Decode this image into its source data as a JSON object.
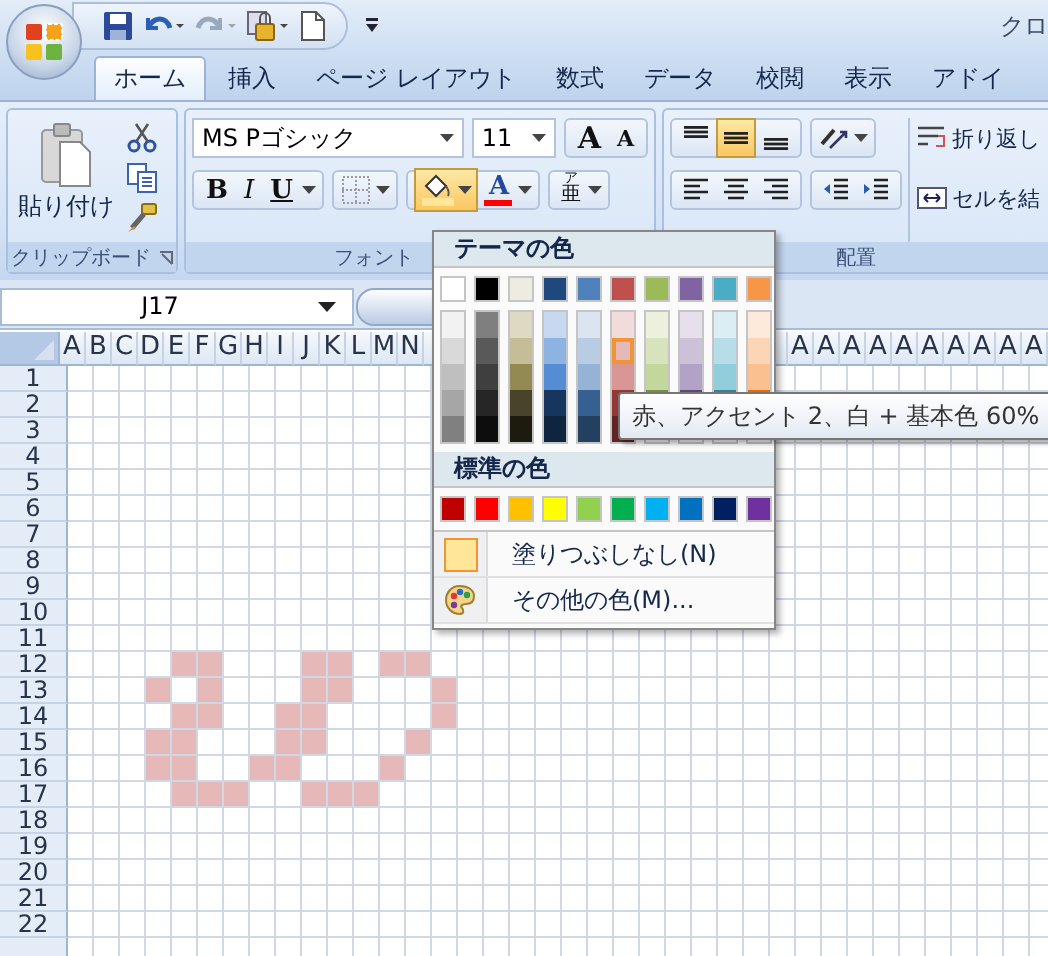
{
  "title": "クロ",
  "tabs": [
    {
      "label": "ホーム",
      "selected": true
    },
    {
      "label": "挿入",
      "selected": false
    },
    {
      "label": "ページ レイアウト",
      "selected": false
    },
    {
      "label": "数式",
      "selected": false
    },
    {
      "label": "データ",
      "selected": false
    },
    {
      "label": "校閲",
      "selected": false
    },
    {
      "label": "表示",
      "selected": false
    },
    {
      "label": "アドイ",
      "selected": false
    }
  ],
  "clipboard": {
    "paste_label": "貼り付け",
    "group_label": "クリップボード"
  },
  "font": {
    "font_name": "MS Pゴシック",
    "font_size": "11",
    "grow_glyph": "A",
    "shrink_glyph": "A",
    "bold": "B",
    "italic": "I",
    "underline": "U",
    "fill_button": {
      "open": true,
      "color": "#ffe699"
    },
    "font_color_button": {
      "glyph": "A",
      "color": "#ff0000"
    },
    "phonetic_ruby": "ア",
    "phonetic_glyph": "亜",
    "group_label": "フォント"
  },
  "alignment": {
    "vertical": [
      {
        "selected": false
      },
      {
        "selected": true
      },
      {
        "selected": false
      }
    ],
    "wrap_text": "折り返し",
    "merge": "セルを結",
    "group_label": "配置"
  },
  "name_box": "J17",
  "sheet": {
    "columns_left": [
      "A",
      "B",
      "C",
      "D",
      "E",
      "F",
      "G",
      "H",
      "I",
      "J",
      "K",
      "L",
      "M",
      "N"
    ],
    "columns_right": [
      "A",
      "A",
      "A",
      "A",
      "A",
      "A",
      "A",
      "A",
      "A",
      "A"
    ],
    "fill": {
      "color": "#e6b8b7"
    },
    "rows": [
      {
        "label": "1"
      },
      {
        "label": "2"
      },
      {
        "label": "3"
      },
      {
        "label": "4"
      },
      {
        "label": "5"
      },
      {
        "label": "6"
      },
      {
        "label": "7"
      },
      {
        "label": "8"
      },
      {
        "label": "9"
      },
      {
        "label": "10"
      },
      {
        "label": "11"
      },
      {
        "label": "12",
        "filled": [
          false,
          false,
          false,
          false,
          true,
          true,
          false,
          false,
          false,
          true,
          true,
          false,
          true,
          true,
          false
        ]
      },
      {
        "label": "13",
        "filled": [
          false,
          false,
          false,
          true,
          false,
          true,
          false,
          false,
          false,
          true,
          true,
          false,
          false,
          false,
          true
        ]
      },
      {
        "label": "14",
        "filled": [
          false,
          false,
          false,
          false,
          true,
          true,
          false,
          false,
          true,
          true,
          false,
          false,
          false,
          false,
          true
        ]
      },
      {
        "label": "15",
        "filled": [
          false,
          false,
          false,
          true,
          true,
          false,
          false,
          false,
          true,
          true,
          false,
          false,
          false,
          true,
          false
        ]
      },
      {
        "label": "16",
        "filled": [
          false,
          false,
          false,
          true,
          true,
          false,
          false,
          true,
          true,
          false,
          false,
          false,
          true,
          false,
          false
        ]
      },
      {
        "label": "17",
        "filled": [
          false,
          false,
          false,
          false,
          true,
          true,
          true,
          false,
          false,
          true,
          true,
          true,
          false,
          false,
          false
        ]
      },
      {
        "label": "18"
      },
      {
        "label": "19"
      },
      {
        "label": "20"
      },
      {
        "label": "21"
      },
      {
        "label": "22"
      }
    ]
  },
  "color_menu": {
    "theme_heading": "テーマの色",
    "theme_colors": [
      {
        "color": "#ffffff",
        "shades": [
          {
            "color": "#f2f2f2",
            "selected": false
          },
          {
            "color": "#d9d9d9",
            "selected": false
          },
          {
            "color": "#bfbfbf",
            "selected": false
          },
          {
            "color": "#a6a6a6",
            "selected": false
          },
          {
            "color": "#808080",
            "selected": false
          }
        ]
      },
      {
        "color": "#000000",
        "shades": [
          {
            "color": "#7f7f7f",
            "selected": false
          },
          {
            "color": "#595959",
            "selected": false
          },
          {
            "color": "#3f3f3f",
            "selected": false
          },
          {
            "color": "#262626",
            "selected": false
          },
          {
            "color": "#0d0d0d",
            "selected": false
          }
        ]
      },
      {
        "color": "#eeece1",
        "shades": [
          {
            "color": "#ddd9c3",
            "selected": false
          },
          {
            "color": "#c4bd97",
            "selected": false
          },
          {
            "color": "#938953",
            "selected": false
          },
          {
            "color": "#494429",
            "selected": false
          },
          {
            "color": "#1d1b10",
            "selected": false
          }
        ]
      },
      {
        "color": "#1f497d",
        "shades": [
          {
            "color": "#c6d9f0",
            "selected": false
          },
          {
            "color": "#8db3e2",
            "selected": false
          },
          {
            "color": "#548dd4",
            "selected": false
          },
          {
            "color": "#17365d",
            "selected": false
          },
          {
            "color": "#0f243e",
            "selected": false
          }
        ]
      },
      {
        "color": "#4f81bd",
        "shades": [
          {
            "color": "#dbe5f1",
            "selected": false
          },
          {
            "color": "#b8cce4",
            "selected": false
          },
          {
            "color": "#95b3d7",
            "selected": false
          },
          {
            "color": "#366092",
            "selected": false
          },
          {
            "color": "#244061",
            "selected": false
          }
        ]
      },
      {
        "color": "#c0504d",
        "shades": [
          {
            "color": "#f2dcdb",
            "selected": false
          },
          {
            "color": "#e5b9b7",
            "selected": true
          },
          {
            "color": "#d99694",
            "selected": false
          },
          {
            "color": "#953734",
            "selected": false
          },
          {
            "color": "#632423",
            "selected": false
          }
        ]
      },
      {
        "color": "#9bbb59",
        "shades": [
          {
            "color": "#ebf1dd",
            "selected": false
          },
          {
            "color": "#d7e3bc",
            "selected": false
          },
          {
            "color": "#c3d69b",
            "selected": false
          },
          {
            "color": "#76923c",
            "selected": false
          }
        ]
      },
      {
        "color": "#8064a2",
        "shades": [
          {
            "color": "#e5e0ec",
            "selected": false
          },
          {
            "color": "#ccc1d9",
            "selected": false
          },
          {
            "color": "#b2a2c7",
            "selected": false
          },
          {
            "color": "#5f497a",
            "selected": false
          }
        ]
      },
      {
        "color": "#4bacc6",
        "shades": [
          {
            "color": "#dbeef3",
            "selected": false
          },
          {
            "color": "#b7dde8",
            "selected": false
          },
          {
            "color": "#92cddc",
            "selected": false
          },
          {
            "color": "#31859b",
            "selected": false
          }
        ]
      },
      {
        "color": "#f79646",
        "shades": [
          {
            "color": "#fdeada",
            "selected": false
          },
          {
            "color": "#fbd5b5",
            "selected": false
          },
          {
            "color": "#fac08f",
            "selected": false
          },
          {
            "color": "#e36c09",
            "selected": false
          }
        ]
      }
    ],
    "standard_heading": "標準の色",
    "standard_colors": [
      {
        "color": "#c00000"
      },
      {
        "color": "#ff0000"
      },
      {
        "color": "#ffc000"
      },
      {
        "color": "#ffff00"
      },
      {
        "color": "#92d050"
      },
      {
        "color": "#00b050"
      },
      {
        "color": "#00b0f0"
      },
      {
        "color": "#0070c0"
      },
      {
        "color": "#002060"
      },
      {
        "color": "#7030a0"
      }
    ],
    "no_fill": "塗りつぶしなし(N)",
    "more_colors": "その他の色(M)..."
  },
  "tooltip": "赤、アクセント 2、白 + 基本色 60%"
}
